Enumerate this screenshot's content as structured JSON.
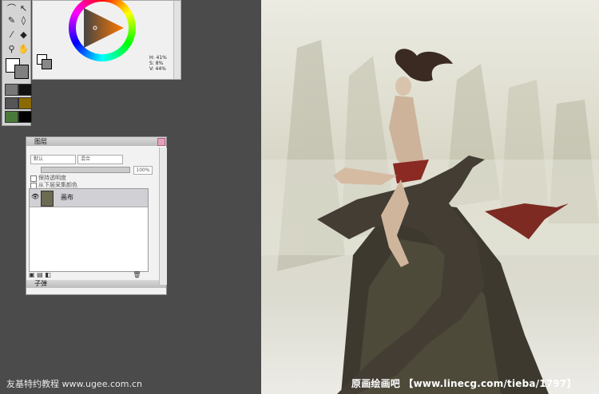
{
  "color_panel": {
    "hsv_h": "H: 41%",
    "hsv_s": "S: 8%",
    "hsv_v": "V: 44%"
  },
  "layers_panel": {
    "title": "图层",
    "mode_select": "默认",
    "blend_select": "混合",
    "opacity_value": "100%",
    "option_preserve": "保持透明度",
    "option_pick": "从下层采集颜色",
    "layers": [
      {
        "name": "画布"
      }
    ],
    "sub_panel_title": "子弹"
  },
  "footer": {
    "left_watermark": "友基特约教程 www.ugee.com.cn",
    "right_watermark": "原画绘画吧 【www.linecg.com/tieba/1797】"
  }
}
